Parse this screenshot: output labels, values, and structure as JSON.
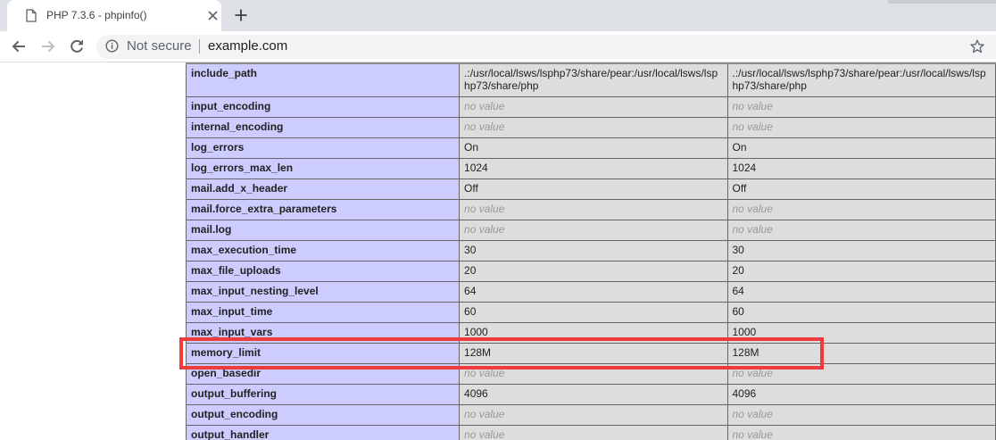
{
  "browser": {
    "tab_title": "PHP 7.3.6 - phpinfo()",
    "security_label": "Not secure",
    "url": "example.com",
    "icons": {
      "tab": "document-icon",
      "close": "close-icon",
      "new_tab": "plus-icon",
      "back": "arrow-left-icon",
      "forward": "arrow-right-icon",
      "reload": "reload-icon",
      "info": "info-icon",
      "bookmark": "star-icon"
    }
  },
  "phpinfo": {
    "rows": [
      {
        "directive": "include_path",
        "local": ".:/usr/local/lsws/lsphp73/share/pear:/usr/local/lsws/lsphp73/share/php",
        "master": ".:/usr/local/lsws/lsphp73/share/pear:/usr/local/lsws/lsphp73/share/php",
        "no_value": false
      },
      {
        "directive": "input_encoding",
        "local": "no value",
        "master": "no value",
        "no_value": true
      },
      {
        "directive": "internal_encoding",
        "local": "no value",
        "master": "no value",
        "no_value": true
      },
      {
        "directive": "log_errors",
        "local": "On",
        "master": "On",
        "no_value": false
      },
      {
        "directive": "log_errors_max_len",
        "local": "1024",
        "master": "1024",
        "no_value": false
      },
      {
        "directive": "mail.add_x_header",
        "local": "Off",
        "master": "Off",
        "no_value": false
      },
      {
        "directive": "mail.force_extra_parameters",
        "local": "no value",
        "master": "no value",
        "no_value": true
      },
      {
        "directive": "mail.log",
        "local": "no value",
        "master": "no value",
        "no_value": true
      },
      {
        "directive": "max_execution_time",
        "local": "30",
        "master": "30",
        "no_value": false
      },
      {
        "directive": "max_file_uploads",
        "local": "20",
        "master": "20",
        "no_value": false
      },
      {
        "directive": "max_input_nesting_level",
        "local": "64",
        "master": "64",
        "no_value": false
      },
      {
        "directive": "max_input_time",
        "local": "60",
        "master": "60",
        "no_value": false
      },
      {
        "directive": "max_input_vars",
        "local": "1000",
        "master": "1000",
        "no_value": false
      },
      {
        "directive": "memory_limit",
        "local": "128M",
        "master": "128M",
        "no_value": false
      },
      {
        "directive": "open_basedir",
        "local": "no value",
        "master": "no value",
        "no_value": true
      },
      {
        "directive": "output_buffering",
        "local": "4096",
        "master": "4096",
        "no_value": false
      },
      {
        "directive": "output_encoding",
        "local": "no value",
        "master": "no value",
        "no_value": true
      },
      {
        "directive": "output_handler",
        "local": "no value",
        "master": "no value",
        "no_value": true
      }
    ],
    "highlighted_directive": "memory_limit"
  },
  "colors": {
    "directive_bg": "#ccccff",
    "value_bg": "#dddddd",
    "no_value_text": "#999999",
    "highlight": "#ee3b3b"
  }
}
